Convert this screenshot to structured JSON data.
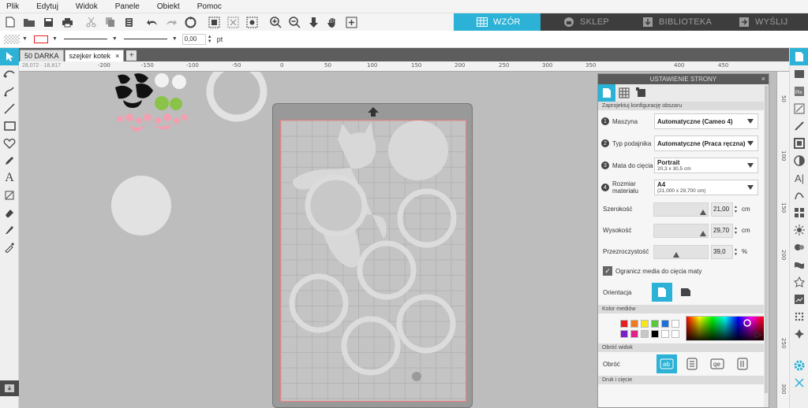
{
  "menu": [
    "Plik",
    "Edytuj",
    "Widok",
    "Panele",
    "Obiekt",
    "Pomoc"
  ],
  "nav_tabs": [
    {
      "label": "WZÓR",
      "icon": "grid-icon"
    },
    {
      "label": "SKLEP",
      "icon": "store-icon"
    },
    {
      "label": "BIBLIOTEKA",
      "icon": "library-icon"
    },
    {
      "label": "WYŚLIJ",
      "icon": "send-icon"
    }
  ],
  "linebar": {
    "line_width": "0,00",
    "unit": "pt"
  },
  "doc_tabs": [
    "50 DARKA",
    "szejker kotek"
  ],
  "ruler_labels": [
    "-200",
    "-150",
    "-100",
    "-50",
    "0",
    "50",
    "100",
    "150",
    "200",
    "250",
    "300",
    "350",
    "400",
    "450"
  ],
  "vruler_labels": [
    "50",
    "100",
    "150",
    "200",
    "250",
    "300"
  ],
  "cursor_coords": "28,072 · 18,817",
  "page_setup": {
    "title": "USTAWIENIE STRONY",
    "close": "×",
    "section_configure": "Zaprojektuj konfigurację obszaru",
    "machine": {
      "num": "1",
      "label": "Maszyna",
      "value": "Automatyczne (Cameo 4)"
    },
    "feed": {
      "num": "2",
      "label": "Typ podajnika",
      "value": "Automatyczne (Praca ręczna)"
    },
    "mat": {
      "num": "3",
      "label": "Mata do cięcia",
      "value": "Portrait",
      "sub": "20,3 x 30,5 cm"
    },
    "media": {
      "num": "4",
      "label": "Rozmiar materiału",
      "value": "A4",
      "sub": "(21,000 x 29,700 cm)"
    },
    "width": {
      "label": "Szerokość",
      "value": "21,00",
      "unit": "cm"
    },
    "height": {
      "label": "Wysokość",
      "value": "29,70",
      "unit": "cm"
    },
    "transparency": {
      "label": "Przezroczystość",
      "value": "39,0",
      "unit": "%"
    },
    "limit_media": {
      "label": "Ogranicz media do cięcia maty",
      "checked": true
    },
    "orientation_label": "Orientacja",
    "section_color": "Kolor mediów",
    "swatches": [
      "#e41e1e",
      "#f07b1e",
      "#f5e61e",
      "#5ac83c",
      "#1e6fd8",
      "#ffffff",
      "#7a1ec8",
      "#e61e8c",
      "#c8c8c8",
      "#000000",
      "#ffffff",
      "#ffffff"
    ],
    "section_rotate": "Obróć widok",
    "rotate_label": "Obróć",
    "section_bottom": "Druk i cięcie"
  },
  "colors": {
    "accent": "#2bb2d6",
    "navbar": "#3d3d3d",
    "mat_border": "#f08080"
  }
}
